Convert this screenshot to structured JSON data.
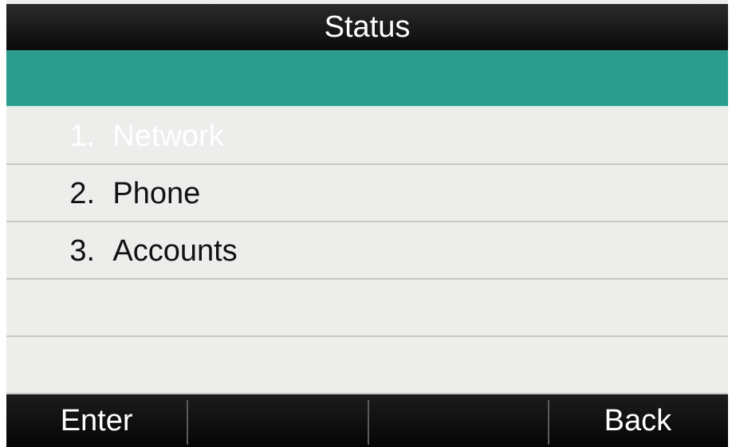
{
  "title": "Status",
  "menu": {
    "items": [
      {
        "number": "1.",
        "label": "Network",
        "selected": true
      },
      {
        "number": "2.",
        "label": "Phone",
        "selected": false
      },
      {
        "number": "3.",
        "label": "Accounts",
        "selected": false
      }
    ]
  },
  "softkeys": {
    "key1": "Enter",
    "key2": "",
    "key3": "",
    "key4": "Back"
  },
  "colors": {
    "selected_row": "#2a9d8f",
    "row_background": "#ededeb",
    "bar_background": "#0a0a0a"
  }
}
